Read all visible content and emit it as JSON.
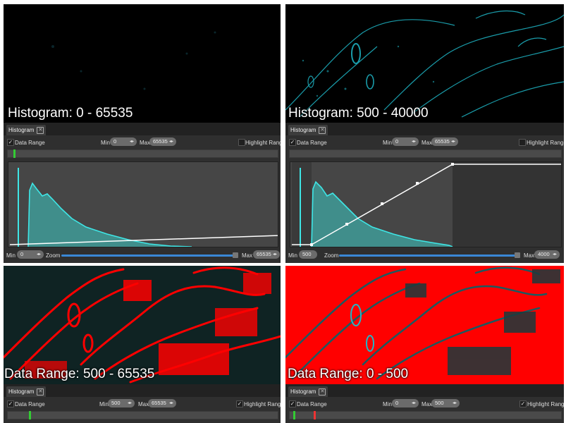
{
  "quadrants": {
    "tl": {
      "caption": "Histogram: 0 - 65535",
      "tab_label": "Histogram",
      "data_range_label": "Data Range",
      "data_range_checked": true,
      "min_label": "Min",
      "min_value": "0",
      "max_label": "Max",
      "max_value": "65535",
      "highlight_label": "Highlight Range",
      "highlight_checked": false,
      "footer": {
        "min_label": "Min",
        "min_value": "0",
        "zoom_label": "Zoom",
        "max_label": "Max",
        "max_value": "65535"
      }
    },
    "tr": {
      "caption": "Histogram: 500 - 40000",
      "tab_label": "Histogram",
      "data_range_label": "Data Range",
      "data_range_checked": true,
      "min_label": "Min",
      "min_value": "0",
      "max_label": "Max",
      "max_value": "65535",
      "highlight_label": "Highlight Range",
      "highlight_checked": false,
      "footer": {
        "min_label": "Min",
        "min_value": "500",
        "zoom_label": "Zoom",
        "max_label": "Max",
        "max_value": "4000"
      }
    },
    "bl": {
      "caption": "Data Range: 500 - 65535",
      "tab_label": "Histogram",
      "data_range_label": "Data Range",
      "data_range_checked": true,
      "min_label": "Min",
      "min_value": "500",
      "max_label": "Max",
      "max_value": "65535",
      "highlight_label": "Highlight Range",
      "highlight_checked": true
    },
    "br": {
      "caption": "Data Range: 0 - 500",
      "tab_label": "Histogram",
      "data_range_label": "Data Range",
      "data_range_checked": true,
      "min_label": "Min",
      "min_value": "0",
      "max_label": "Max",
      "max_value": "500",
      "highlight_label": "Highlight Range",
      "highlight_checked": true
    }
  },
  "icons": {
    "tab_close": "close-icon",
    "checkbox": "checkmark-icon",
    "spinner": "spinner-arrows-icon"
  },
  "colors": {
    "histogram_fill": "#3fa7a3",
    "histogram_line": "#3ee6e6",
    "highlight": "#ff0000",
    "slider": "#3a87d6",
    "cyan_tissue": "#1fb8c8"
  }
}
